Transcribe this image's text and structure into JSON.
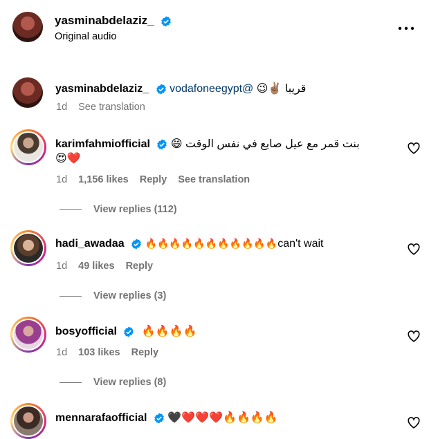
{
  "header": {
    "username": "yasminabdelaziz_",
    "subtitle": "Original audio"
  },
  "caption": {
    "username": "yasminabdelaziz_",
    "mention": "vodafoneegypt@",
    "text": "قريبا",
    "emojis": "😉✌🏽",
    "time": "1d",
    "see_translation": "See translation"
  },
  "comments": [
    {
      "username": "karimfahmiofficial",
      "text": "بنت قمر مع عيل صايع في نفس الوقت",
      "emoji_line1": "😄",
      "emoji_line2": "😍❤️",
      "time": "1d",
      "likes": "1,156 likes",
      "reply": "Reply",
      "see_translation": "See translation",
      "view_replies": "View replies (112)"
    },
    {
      "username": "hadi_awadaa",
      "emojis": "🔥🔥🔥🔥🔥🔥🔥🔥🔥🔥🔥",
      "text": "can't wait",
      "time": "1d",
      "likes": "49 likes",
      "reply": "Reply",
      "view_replies": "View replies (3)"
    },
    {
      "username": "bosyofficial",
      "emojis": "🔥🔥🔥🔥",
      "time": "1d",
      "likes": "103 likes",
      "reply": "Reply",
      "view_replies": "View replies (8)"
    },
    {
      "username": "mennarafaofficial",
      "emojis": "🖤❤️❤️❤️🔥🔥🔥🔥"
    }
  ],
  "colors": {
    "verified": "#0095f6",
    "mention": "#00376b",
    "secondary_text": "#737373"
  },
  "icons": {
    "more": "more-horizontal-icon",
    "like": "heart-outline-icon",
    "verified": "verified-badge-icon"
  }
}
